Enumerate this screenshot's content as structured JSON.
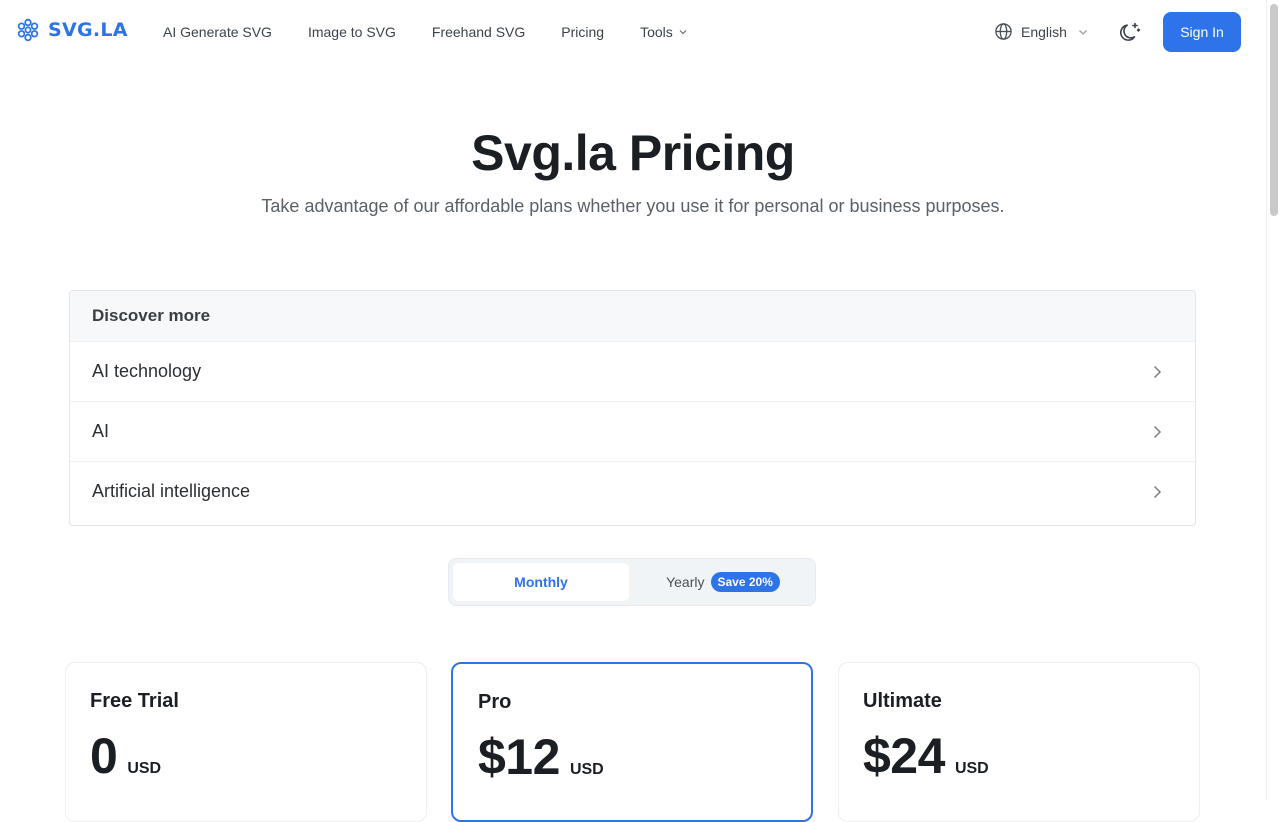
{
  "header": {
    "logo_text": "SVG.LA",
    "nav": [
      {
        "label": "AI Generate SVG"
      },
      {
        "label": "Image to SVG"
      },
      {
        "label": "Freehand SVG"
      },
      {
        "label": "Pricing"
      },
      {
        "label": "Tools"
      }
    ],
    "language": "English",
    "sign_in": "Sign In"
  },
  "hero": {
    "title": "Svg.la Pricing",
    "subtitle": "Take advantage of our affordable plans whether you use it for personal or business purposes."
  },
  "discover": {
    "title": "Discover more",
    "items": [
      {
        "label": "AI technology"
      },
      {
        "label": "AI"
      },
      {
        "label": "Artificial intelligence"
      }
    ]
  },
  "billing": {
    "monthly": "Monthly",
    "yearly": "Yearly",
    "save_badge": "Save 20%"
  },
  "plans": [
    {
      "name": "Free Trial",
      "price": "0",
      "currency": "USD"
    },
    {
      "name": "Pro",
      "price": "$12",
      "currency": "USD"
    },
    {
      "name": "Ultimate",
      "price": "$24",
      "currency": "USD"
    }
  ],
  "colors": {
    "accent": "#2e73ea",
    "text": "#1b1f23",
    "muted": "#5a6068"
  }
}
